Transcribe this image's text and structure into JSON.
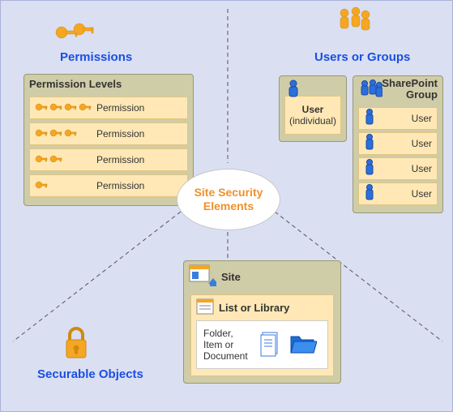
{
  "diagram": {
    "center_label": "Site Security Elements",
    "permissions": {
      "title": "Permissions",
      "panel_title": "Permission Levels",
      "rows": [
        {
          "label": "Permission",
          "keys": 4
        },
        {
          "label": "Permission",
          "keys": 3
        },
        {
          "label": "Permission",
          "keys": 2
        },
        {
          "label": "Permission",
          "keys": 1
        }
      ]
    },
    "users_groups": {
      "title": "Users or Groups",
      "user_box": {
        "title": "User",
        "subtitle": "(individual)"
      },
      "group_box": {
        "title": "SharePoint Group",
        "rows": [
          {
            "label": "User"
          },
          {
            "label": "User"
          },
          {
            "label": "User"
          },
          {
            "label": "User"
          }
        ]
      }
    },
    "securable_objects": {
      "title": "Securable Objects",
      "site_label": "Site",
      "list_label": "List or Library",
      "folder_label": "Folder, Item or Document"
    },
    "colors": {
      "bg": "#dadff2",
      "panel": "#cfcca8",
      "row": "#ffe8b5",
      "title": "#1a4fe0",
      "accent": "#f0902b"
    }
  },
  "chart_data": {
    "type": "diagram",
    "title": "Site Security Elements",
    "nodes": [
      {
        "id": "center",
        "label": "Site Security Elements"
      },
      {
        "id": "permissions",
        "label": "Permissions",
        "children": [
          {
            "id": "permission_levels",
            "label": "Permission Levels",
            "items": [
              "Permission",
              "Permission",
              "Permission",
              "Permission"
            ]
          }
        ]
      },
      {
        "id": "users_groups",
        "label": "Users or Groups",
        "children": [
          {
            "id": "user_individual",
            "label": "User (individual)"
          },
          {
            "id": "sharepoint_group",
            "label": "SharePoint Group",
            "items": [
              "User",
              "User",
              "User",
              "User"
            ]
          }
        ]
      },
      {
        "id": "securable_objects",
        "label": "Securable Objects",
        "children": [
          {
            "id": "site",
            "label": "Site",
            "children": [
              {
                "id": "list_library",
                "label": "List or Library",
                "children": [
                  {
                    "id": "folder_item_doc",
                    "label": "Folder, Item or Document"
                  }
                ]
              }
            ]
          }
        ]
      }
    ],
    "edges": [
      {
        "from": "center",
        "to": "permissions"
      },
      {
        "from": "center",
        "to": "users_groups"
      },
      {
        "from": "center",
        "to": "securable_objects"
      }
    ]
  }
}
